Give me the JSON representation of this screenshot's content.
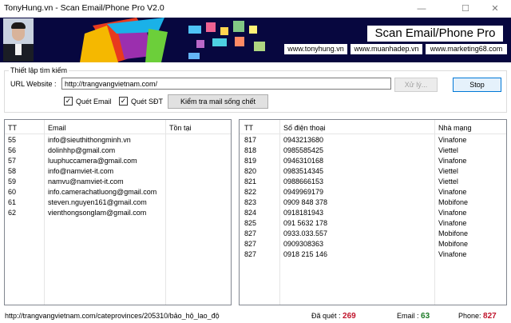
{
  "window": {
    "title": "TonyHung.vn - Scan Email/Phone Pro V2.0",
    "controls": [
      "—",
      "☐",
      "✕"
    ]
  },
  "banner": {
    "app_title": "Scan Email/Phone Pro",
    "links": [
      "www.tonyhung.vn",
      "www.muanhadep.vn",
      "www.marketing68.com"
    ]
  },
  "settings": {
    "group_label": "Thiết lập tìm kiếm",
    "url_label": "URL Website :",
    "url_value": "http://trangvangvietnam.com/",
    "process_button": "Xử lý...",
    "stop_button": "Stop",
    "scan_email_label": "Quét Email",
    "scan_email_checked": true,
    "scan_phone_label": "Quét SĐT",
    "scan_phone_checked": true,
    "check_mail_button": "Kiểm tra mail sống chết"
  },
  "email_table": {
    "columns": [
      "TT",
      "Email",
      "Tồn tại"
    ],
    "rows": [
      {
        "tt": "55",
        "email": "info@sieuthithongminh.vn",
        "exists": ""
      },
      {
        "tt": "56",
        "email": "dolinhhp@gmail.com",
        "exists": ""
      },
      {
        "tt": "57",
        "email": "luuphuccamera@gmail.com",
        "exists": ""
      },
      {
        "tt": "58",
        "email": "info@namviet-it.com",
        "exists": ""
      },
      {
        "tt": "59",
        "email": "namvu@namviet-it.com",
        "exists": ""
      },
      {
        "tt": "60",
        "email": "info.camerachatluong@gmail.com",
        "exists": ""
      },
      {
        "tt": "61",
        "email": "steven.nguyen161@gmail.com",
        "exists": ""
      },
      {
        "tt": "62",
        "email": "vienthongsonglam@gmail.com",
        "exists": ""
      }
    ]
  },
  "phone_table": {
    "columns": [
      "TT",
      "Số điện thoại",
      "Nhà mạng"
    ],
    "rows": [
      {
        "tt": "817",
        "phone": "0943213680",
        "carrier": "Vinafone"
      },
      {
        "tt": "818",
        "phone": "0985585425",
        "carrier": "Viettel"
      },
      {
        "tt": "819",
        "phone": "0946310168",
        "carrier": "Vinafone"
      },
      {
        "tt": "820",
        "phone": "0983514345",
        "carrier": "Viettel"
      },
      {
        "tt": "821",
        "phone": "0988666153",
        "carrier": "Viettel"
      },
      {
        "tt": "822",
        "phone": "0949969179",
        "carrier": "Vinafone"
      },
      {
        "tt": "823",
        "phone": "0909 848 378",
        "carrier": "Mobifone"
      },
      {
        "tt": "824",
        "phone": "0918181943",
        "carrier": "Vinafone"
      },
      {
        "tt": "825",
        "phone": "091 5632 178",
        "carrier": "Vinafone"
      },
      {
        "tt": "827",
        "phone": "0933.033.557",
        "carrier": "Mobifone"
      },
      {
        "tt": "827",
        "phone": "0909308363",
        "carrier": "Mobifone"
      },
      {
        "tt": "827",
        "phone": "0918 215 146",
        "carrier": "Vinafone"
      }
    ]
  },
  "status_bar": {
    "current_url": "http://trangvangvietnam.com/cateprovinces/205310/bảo_hộ_lao_độ",
    "scanned_label": "Đã quét :",
    "scanned_count": "269",
    "email_label": "Email :",
    "email_count": "63",
    "phone_label": "Phone:",
    "phone_count": "827"
  }
}
